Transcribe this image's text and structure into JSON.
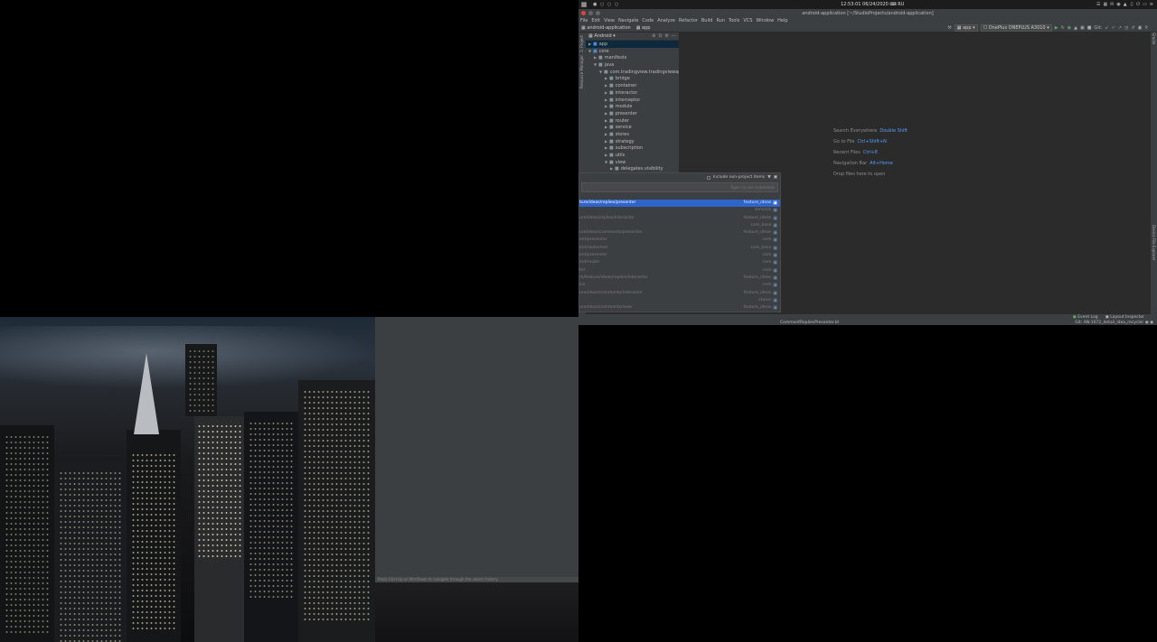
{
  "system_bar": {
    "workspaces": "● ○ ○ ○",
    "clock": "12:53:01 06/24/2020",
    "layout": "RU",
    "tray_icons": [
      "menu-icon",
      "folder-icon",
      "chat-icon",
      "shield-icon",
      "network-icon",
      "volume-icon",
      "power-icon",
      "battery-icon",
      "notification-icon"
    ]
  },
  "window": {
    "title": "android-application [~/StudioProjects/android-application]"
  },
  "menu": [
    "File",
    "Edit",
    "View",
    "Navigate",
    "Code",
    "Analyze",
    "Refactor",
    "Build",
    "Run",
    "Tools",
    "VCS",
    "Window",
    "Help"
  ],
  "breadcrumbs": [
    "android-application",
    "app"
  ],
  "toolbar": {
    "module": "app",
    "device": "OnePlus ONEPLUS A3010",
    "git_label": "Git:"
  },
  "project_panel": {
    "view": "Android",
    "tree": [
      {
        "label": "app",
        "type": "module",
        "depth": 0,
        "open": false,
        "selected": true
      },
      {
        "label": "core",
        "type": "module",
        "depth": 0,
        "open": true
      },
      {
        "label": "manifests",
        "type": "folder",
        "depth": 1,
        "open": false
      },
      {
        "label": "java",
        "type": "folder",
        "depth": 1,
        "open": true
      },
      {
        "label": "com.tradingview.tradingviewapp.c",
        "type": "folder",
        "depth": 2,
        "open": true
      },
      {
        "label": "bridge",
        "type": "folder",
        "depth": 3,
        "open": false
      },
      {
        "label": "container",
        "type": "folder",
        "depth": 3,
        "open": false
      },
      {
        "label": "interactor",
        "type": "folder",
        "depth": 3,
        "open": false
      },
      {
        "label": "interceptor",
        "type": "folder",
        "depth": 3,
        "open": false
      },
      {
        "label": "module",
        "type": "folder",
        "depth": 3,
        "open": false
      },
      {
        "label": "presenter",
        "type": "folder",
        "depth": 3,
        "open": false
      },
      {
        "label": "router",
        "type": "folder",
        "depth": 3,
        "open": false
      },
      {
        "label": "service",
        "type": "folder",
        "depth": 3,
        "open": false
      },
      {
        "label": "stores",
        "type": "folder",
        "depth": 3,
        "open": false
      },
      {
        "label": "strategy",
        "type": "folder",
        "depth": 3,
        "open": false
      },
      {
        "label": "subscription",
        "type": "folder",
        "depth": 3,
        "open": false
      },
      {
        "label": "utils",
        "type": "folder",
        "depth": 3,
        "open": false
      },
      {
        "label": "view",
        "type": "folder",
        "depth": 3,
        "open": true
      },
      {
        "label": "delegates.visibility",
        "type": "folder",
        "depth": 4,
        "open": false
      }
    ]
  },
  "left_strip": {
    "tab1": "1: Project",
    "tab2": "Resource Manager"
  },
  "right_strip": {
    "tab1": "Gradle",
    "tab2": "Device File Explorer"
  },
  "editor_hints": [
    {
      "label": "Search Everywhere",
      "key": "Double Shift"
    },
    {
      "label": "Go to File",
      "key": "Ctrl+Shift+N"
    },
    {
      "label": "Recent Files",
      "key": "Ctrl+E"
    },
    {
      "label": "Navigation Bar",
      "key": "Alt+Home"
    },
    {
      "label": "Drop files here to open",
      "key": ""
    }
  ],
  "search_popup": {
    "include_label": "Include non-project items",
    "placeholder": "Type / to see commands",
    "results": [
      {
        "path": "ture/ideas/replies/presenter",
        "module": "feature_ideas",
        "selected": true
      },
      {
        "path": "",
        "module": "services"
      },
      {
        "path": "ure/ideas/replies/interactor",
        "module": "feature_ideas"
      },
      {
        "path": "",
        "module": "core_base"
      },
      {
        "path": "ure/ideas/comments/presenter",
        "module": "feature_ideas"
      },
      {
        "path": "ent/presenter",
        "module": "core"
      },
      {
        "path": "ent/router/ext",
        "module": "core_base"
      },
      {
        "path": "ent/presenter",
        "module": "core"
      },
      {
        "path": "ent/router",
        "module": "core"
      },
      {
        "path": "ter",
        "module": "core"
      },
      {
        "path": "m/feature/ideas/replies/interactor",
        "module": "feature_ideas"
      },
      {
        "path": "ice",
        "module": "core"
      },
      {
        "path": "ure/ideas/comments/interactor",
        "module": "feature_ideas"
      },
      {
        "path": "",
        "module": "stores"
      },
      {
        "path": "ure/ideas/comments/view",
        "module": "feature_ideas"
      }
    ]
  },
  "status_bar": {
    "event_log": "Event Log",
    "layout_inspector": "Layout Inspector",
    "file": "CommentRepliesPresenter.kt",
    "git_branch": "Git: AN-1072_detail_idea_recycler"
  },
  "bottom_hint": "Press Ctrl+Up or Alt+Down to navigate through the search history"
}
